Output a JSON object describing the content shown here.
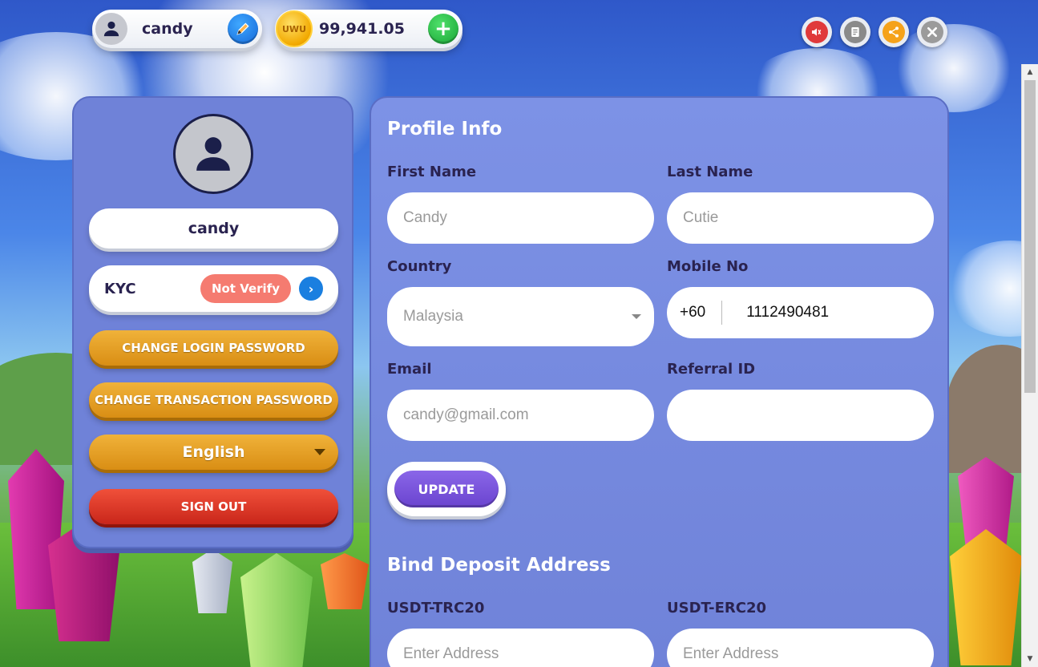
{
  "header": {
    "username": "candy",
    "balance": "99,941.05",
    "coin_label": "UWU"
  },
  "top_icons": [
    {
      "icon": "volume-icon",
      "color": "#e0393a"
    },
    {
      "icon": "notes-icon",
      "color": "#8a8a8a"
    },
    {
      "icon": "share-icon",
      "color": "#f5a21b"
    },
    {
      "icon": "close-icon",
      "color": "#9b9b9b"
    }
  ],
  "left_panel": {
    "display_name": "candy",
    "kyc_label": "KYC",
    "kyc_status": "Not Verify",
    "change_login_password": "CHANGE LOGIN PASSWORD",
    "change_transaction_password": "CHANGE TRANSACTION PASSWORD",
    "language": "English",
    "sign_out": "SIGN OUT"
  },
  "profile": {
    "title": "Profile Info",
    "first_name_label": "First Name",
    "first_name_placeholder": "Candy",
    "last_name_label": "Last Name",
    "last_name_placeholder": "Cutie",
    "country_label": "Country",
    "country_value": "Malaysia",
    "mobile_label": "Mobile No",
    "mobile_code": "+60",
    "mobile_number": "1112490481",
    "email_label": "Email",
    "email_placeholder": "candy@gmail.com",
    "referral_label": "Referral ID",
    "referral_value": "",
    "update_button": "UPDATE"
  },
  "deposit": {
    "title": "Bind Deposit Address",
    "trc20_label": "USDT-TRC20",
    "trc20_placeholder": "Enter Address",
    "erc20_label": "USDT-ERC20",
    "erc20_placeholder": "Enter Address"
  }
}
